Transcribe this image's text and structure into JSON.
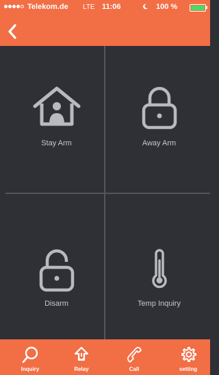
{
  "status_bar": {
    "carrier": "Telekom.de",
    "network": "LTE",
    "time": "11:06",
    "battery_percent": "100 %",
    "moon_icon": "moon-icon",
    "battery_icon": "battery-icon"
  },
  "nav": {
    "back_icon": "chevron-left-icon"
  },
  "tiles": [
    {
      "label": "Stay Arm",
      "icon": "home-person-icon"
    },
    {
      "label": "Away Arm",
      "icon": "lock-closed-icon"
    },
    {
      "label": "Disarm",
      "icon": "lock-open-icon"
    },
    {
      "label": "Temp Inquiry",
      "icon": "thermometer-icon"
    }
  ],
  "tabbar": {
    "tabs": [
      {
        "label": "Inquiry",
        "icon": "magnifier-icon"
      },
      {
        "label": "Relay",
        "icon": "relay-power-icon"
      },
      {
        "label": "Call",
        "icon": "phone-icon"
      },
      {
        "label": "setting",
        "icon": "gear-icon"
      }
    ]
  },
  "colors": {
    "accent": "#f26e45",
    "background": "#2f3036",
    "divider": "#55565c",
    "icon": "#b9babe",
    "tile_text": "#c6c7cb"
  }
}
